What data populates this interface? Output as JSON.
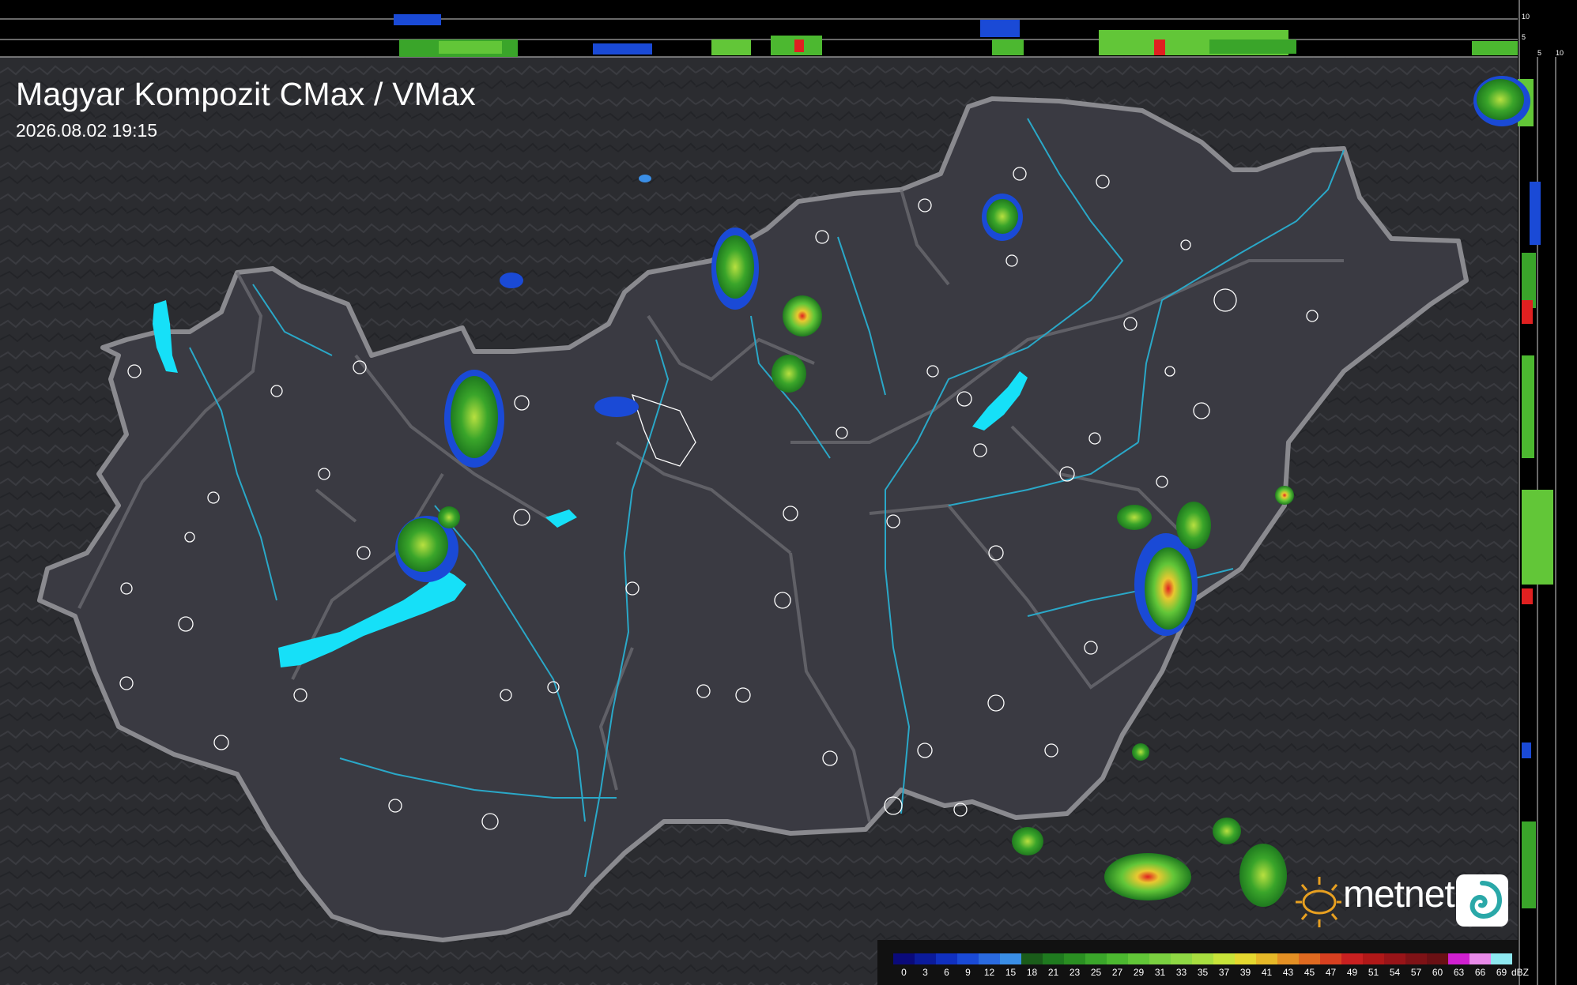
{
  "header": {
    "title": "Magyar Kompozit CMax / VMax",
    "timestamp": "2026.08.02 19:15"
  },
  "profile_scale": {
    "top_labels": [
      "10",
      "5"
    ],
    "side_labels": [
      "5",
      "10"
    ]
  },
  "legend": {
    "unit": "dBZ",
    "labels": [
      "0",
      "3",
      "6",
      "9",
      "12",
      "15",
      "18",
      "21",
      "23",
      "25",
      "27",
      "29",
      "31",
      "33",
      "35",
      "37",
      "39",
      "41",
      "43",
      "45",
      "47",
      "49",
      "51",
      "54",
      "57",
      "60",
      "63",
      "66",
      "69"
    ],
    "colors": [
      "#0a0a7a",
      "#0b1b9b",
      "#1030c0",
      "#1a4ad6",
      "#2a6ae0",
      "#3a8ee6",
      "#1a5c1a",
      "#1f7a1f",
      "#2a8f22",
      "#3aa52a",
      "#4cb830",
      "#62c638",
      "#7ad040",
      "#8fd844",
      "#a8de40",
      "#c8e43a",
      "#e4d830",
      "#e6b828",
      "#e49024",
      "#e06a20",
      "#d84020",
      "#c82020",
      "#b01818",
      "#981418",
      "#7e1216",
      "#6a1014",
      "#d020d0",
      "#e88ae8",
      "#8ee8f0"
    ]
  },
  "brand": {
    "name": "metnet",
    "sun_color": "#e8a020",
    "water_color": "#16e0f8",
    "border_color": "#8a8a8f",
    "river_color": "#2aa8c8"
  },
  "icons": [
    "sun-logo-icon",
    "spiral-app-icon"
  ]
}
